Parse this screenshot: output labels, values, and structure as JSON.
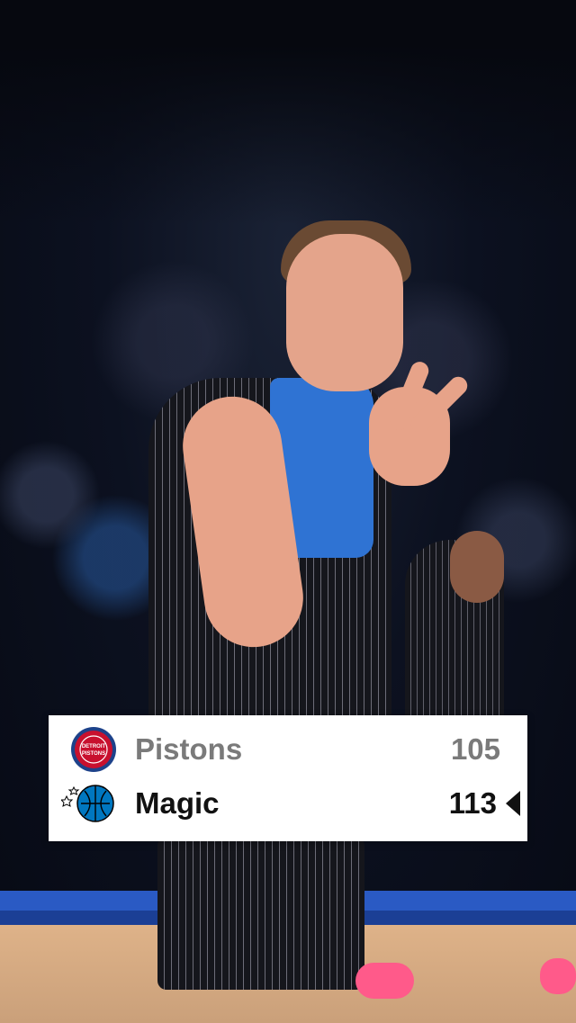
{
  "scoreboard": {
    "home": {
      "name": "Pistons",
      "score": "105",
      "logo_text": "DETROIT PISTONS",
      "color": "#C8102E"
    },
    "away": {
      "name": "Magic",
      "score": "113",
      "logo_icon": "magic-basketball-logo",
      "color": "#0077C0"
    },
    "winner_indicator_icon": "triangle-left-icon"
  },
  "colors": {
    "floor_blue": "#2a5ac4",
    "jersey_blue": "#2f73d3",
    "shoe_pink": "#ff5a8a"
  }
}
